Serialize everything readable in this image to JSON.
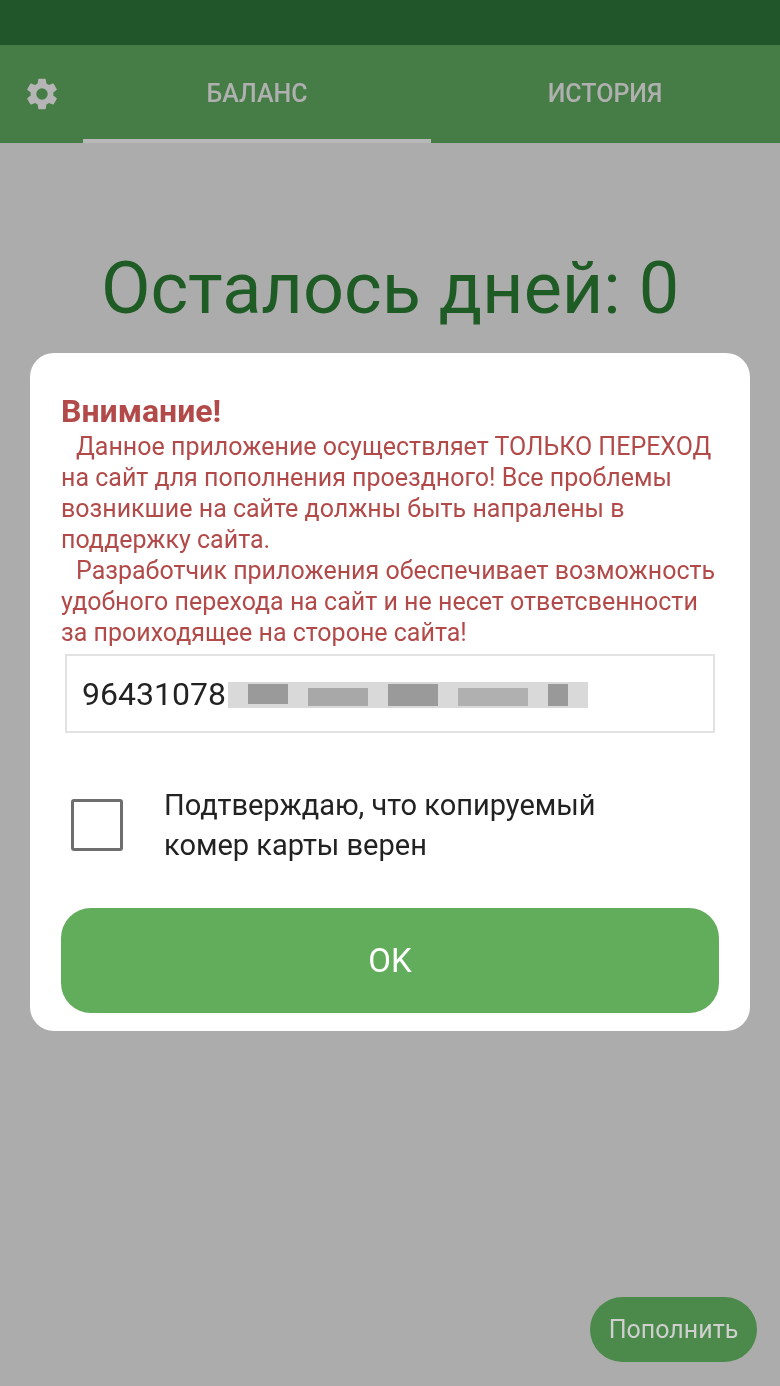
{
  "tabs": [
    {
      "label": "БАЛАНС",
      "selected": true
    },
    {
      "label": "ИСТОРИЯ",
      "selected": false
    }
  ],
  "balance": {
    "days_left": "Осталось дней: 0"
  },
  "dialog": {
    "title": "Внимание!",
    "paragraphs": [
      "Данное приложение осуществляет ТОЛЬКО ПЕРЕХОД на сайт для пополнения проездного! Все проблемы возникшие на сайте должны быть напралены в поддержку сайта.",
      "Разработчик приложения обеспечивает возможность удобного перехода на сайт и не несет ответсвенности за проиходящее на стороне сайта!"
    ],
    "card_number": "96431078",
    "confirm": {
      "label": "Подтверждаю, что копируемый комер карты верен",
      "checked": false
    },
    "ok_button": "OK"
  },
  "topup_button": "Пополнить"
}
